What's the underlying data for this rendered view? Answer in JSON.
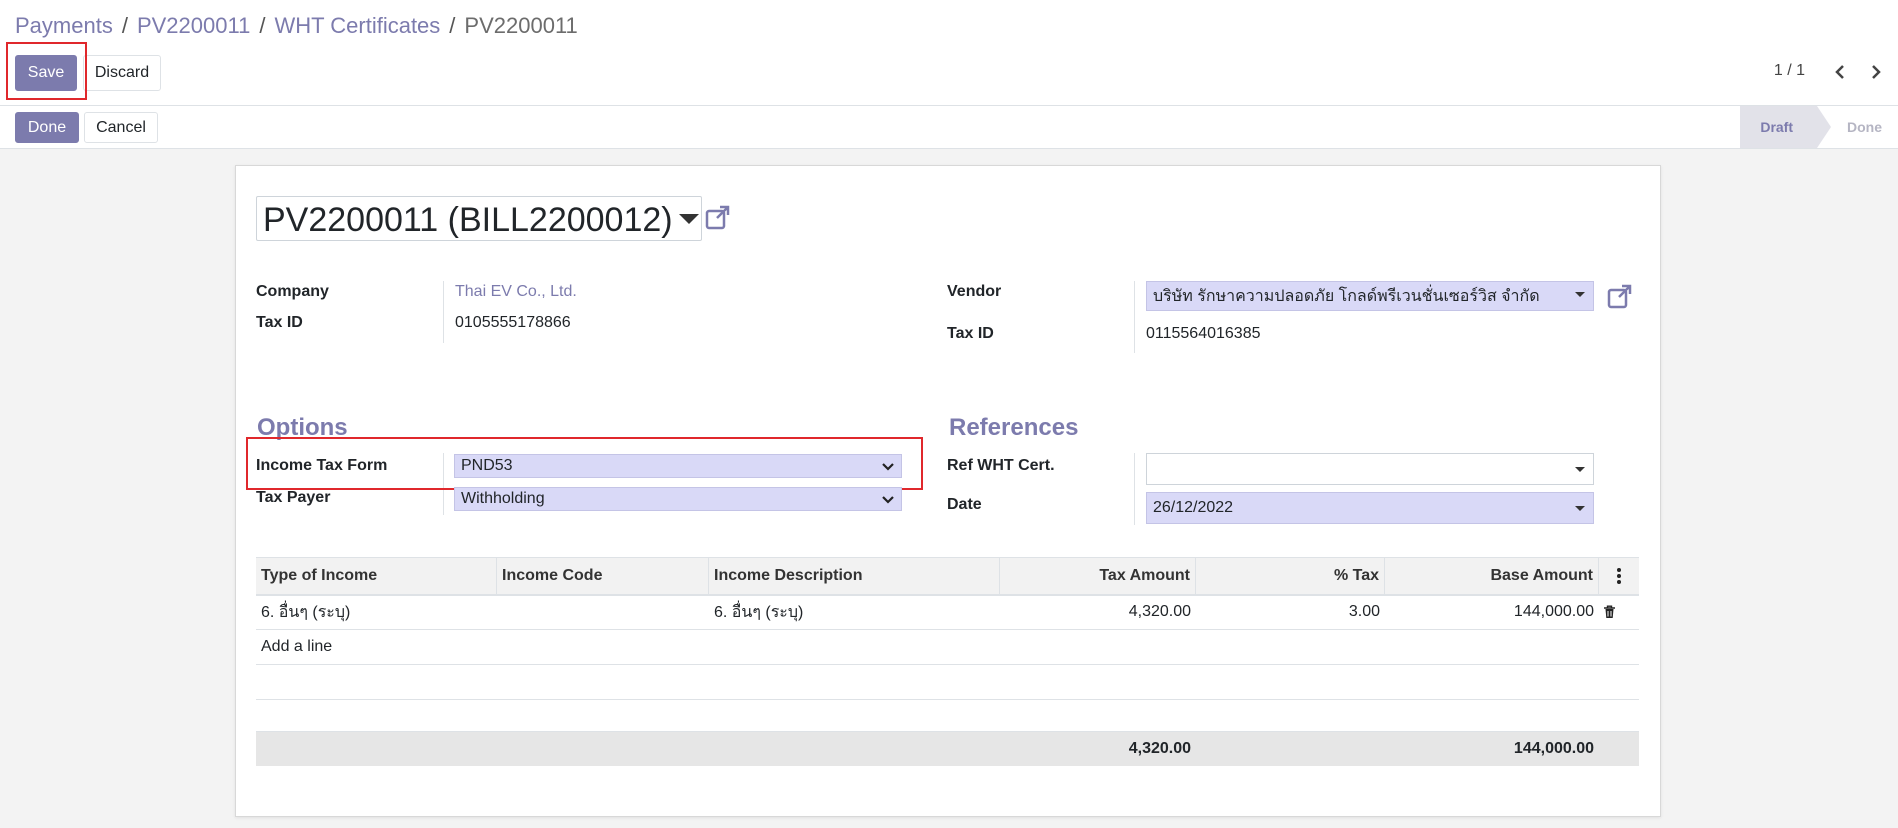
{
  "breadcrumb": {
    "items": [
      "Payments",
      "PV2200011",
      "WHT Certificates"
    ],
    "separator": "/",
    "current": "PV2200011"
  },
  "control_panel": {
    "save_label": "Save",
    "discard_label": "Discard",
    "pager_value": "1 / 1"
  },
  "statusbar": {
    "done_button": "Done",
    "cancel_button": "Cancel",
    "steps": [
      "Draft",
      "Done"
    ],
    "active_step": "Draft"
  },
  "form": {
    "name": "PV2200011 (BILL2200012)",
    "company_label": "Company",
    "company_value": "Thai EV Co., Ltd.",
    "company_tax_id_label": "Tax ID",
    "company_tax_id_value": "0105555178866",
    "vendor_label": "Vendor",
    "vendor_value": "บริษัท รักษาความปลอดภัย โกลด์พรีเวนชั่นเซอร์วิส จำกัด",
    "vendor_tax_id_label": "Tax ID",
    "vendor_tax_id_value": "0115564016385",
    "options_title": "Options",
    "income_tax_form_label": "Income Tax Form",
    "income_tax_form_value": "PND53",
    "tax_payer_label": "Tax Payer",
    "tax_payer_value": "Withholding",
    "references_title": "References",
    "ref_wht_cert_label": "Ref WHT Cert.",
    "ref_wht_cert_value": "",
    "date_label": "Date",
    "date_value": "26/12/2022"
  },
  "lines": {
    "columns": [
      "Type of Income",
      "Income Code",
      "Income Description",
      "Tax Amount",
      "% Tax",
      "Base Amount"
    ],
    "rows": [
      {
        "type_of_income": "6. อื่นๆ (ระบุ)",
        "income_code": "",
        "income_description": "6. อื่นๆ (ระบุ)",
        "tax_amount": "4,320.00",
        "percent_tax": "3.00",
        "base_amount": "144,000.00"
      }
    ],
    "add_line_label": "Add a line",
    "total_tax_amount": "4,320.00",
    "total_base_amount": "144,000.00"
  },
  "colors": {
    "brand": "#7c7bad",
    "required_field_bg": "#d9d9f7",
    "highlight_box": "#e0282c"
  },
  "icons": {
    "external_link": "external-link-icon",
    "trash": "trash-icon",
    "kebab": "vertical-dots-icon",
    "pager_prev": "chevron-left-icon",
    "pager_next": "chevron-right-icon"
  }
}
